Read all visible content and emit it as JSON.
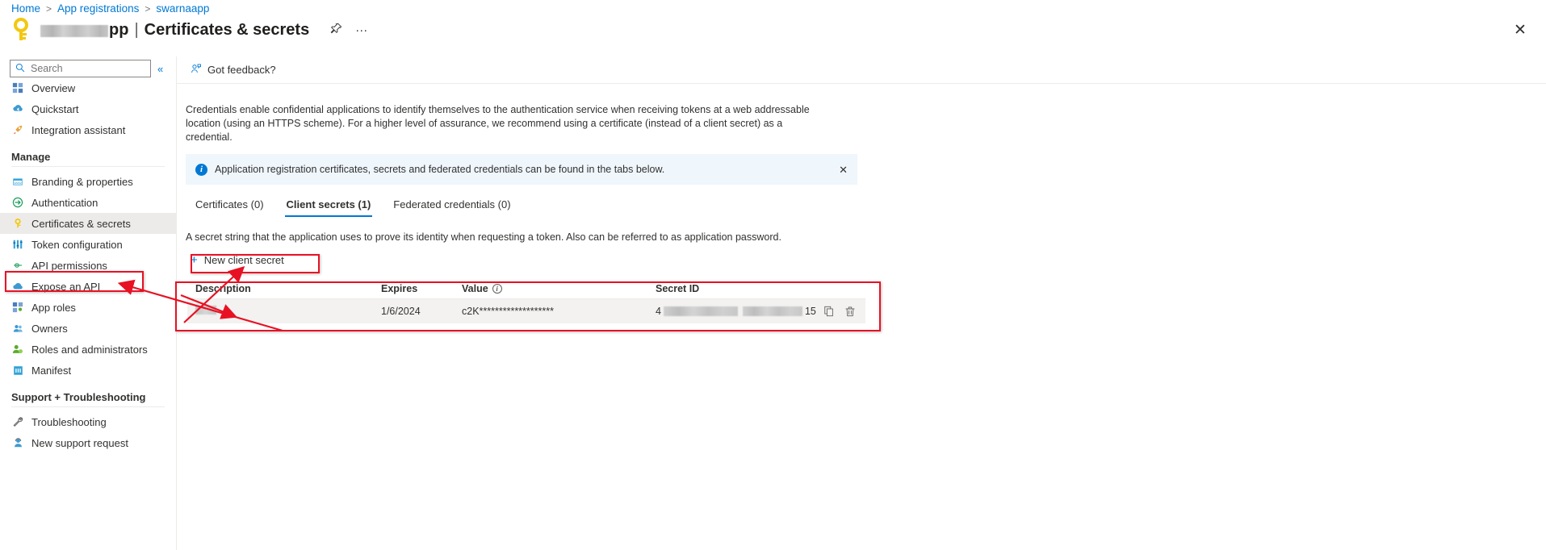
{
  "breadcrumb": {
    "items": [
      "Home",
      "App registrations",
      "swarnaapp"
    ],
    "separator": ">"
  },
  "header": {
    "key_icon": "key-icon",
    "app_name_redacted": true,
    "app_name_visible_suffix": "pp",
    "separator": "|",
    "page_title": "Certificates & secrets",
    "pin_icon": "pin-icon",
    "ellipsis_icon": "more-options-icon",
    "close_icon": "close-icon"
  },
  "sidebar": {
    "search": {
      "placeholder": "Search",
      "value": "",
      "icon": "search-icon"
    },
    "collapse_icon": "«",
    "items": [
      {
        "label": "Overview",
        "icon": "overview-icon",
        "glyph": "▦",
        "color": "#4a7ebb"
      },
      {
        "label": "Quickstart",
        "icon": "quickstart-icon",
        "glyph": "☁",
        "color": "#3d9ad1"
      },
      {
        "label": "Integration assistant",
        "icon": "rocket-icon",
        "glyph": "🚀",
        "color": "#e8a33d"
      }
    ],
    "groups": [
      {
        "title": "Manage",
        "items": [
          {
            "label": "Branding & properties",
            "icon": "branding-icon",
            "glyph": "▤",
            "color": "#31a2d8"
          },
          {
            "label": "Authentication",
            "icon": "authentication-icon",
            "glyph": "➦",
            "color": "#1a9e5c"
          },
          {
            "label": "Certificates & secrets",
            "icon": "key-icon",
            "glyph": "⚷",
            "color": "#f2c811",
            "selected": true
          },
          {
            "label": "Token configuration",
            "icon": "token-configuration-icon",
            "glyph": "⦀",
            "color": "#31a2d8"
          },
          {
            "label": "API permissions",
            "icon": "api-permissions-icon",
            "glyph": "⊸",
            "color": "#1a9e5c"
          },
          {
            "label": "Expose an API",
            "icon": "expose-api-icon",
            "glyph": "☁",
            "color": "#3d9ad1"
          },
          {
            "label": "App roles",
            "icon": "app-roles-icon",
            "glyph": "▦",
            "color": "#4a7ebb"
          },
          {
            "label": "Owners",
            "icon": "owners-icon",
            "glyph": "👥",
            "color": "#3d9ad1"
          },
          {
            "label": "Roles and administrators",
            "icon": "roles-administrators-icon",
            "glyph": "👤",
            "color": "#5cab2e"
          },
          {
            "label": "Manifest",
            "icon": "manifest-icon",
            "glyph": "☲",
            "color": "#31a2d8"
          }
        ]
      },
      {
        "title": "Support + Troubleshooting",
        "items": [
          {
            "label": "Troubleshooting",
            "icon": "troubleshooting-icon",
            "glyph": "🔧",
            "color": "#605e5c"
          },
          {
            "label": "New support request",
            "icon": "support-request-icon",
            "glyph": "👤",
            "color": "#3d9ad1"
          }
        ]
      }
    ]
  },
  "command_bar": {
    "feedback_label": "Got feedback?",
    "feedback_icon": "feedback-icon"
  },
  "main": {
    "description": "Credentials enable confidential applications to identify themselves to the authentication service when receiving tokens at a web addressable location (using an HTTPS scheme). For a higher level of assurance, we recommend using a certificate (instead of a client secret) as a credential.",
    "info_banner": {
      "icon": "info-icon",
      "text": "Application registration certificates, secrets and federated credentials can be found in the tabs below.",
      "close_icon": "close-icon"
    },
    "tabs": [
      {
        "label": "Certificates (0)",
        "active": false
      },
      {
        "label": "Client secrets (1)",
        "active": true
      },
      {
        "label": "Federated credentials (0)",
        "active": false
      }
    ],
    "sub_description": "A secret string that the application uses to prove its identity when requesting a token. Also can be referred to as application password.",
    "new_secret_button": {
      "label": "New client secret",
      "icon": "plus-icon"
    },
    "table": {
      "columns": [
        "Description",
        "Expires",
        "Value",
        "Secret ID"
      ],
      "value_info_icon": "info-icon",
      "rows": [
        {
          "description": "",
          "description_redacted": true,
          "expires": "1/6/2024",
          "value": "c2K*******************",
          "secret_id_prefix": "4",
          "secret_id_suffix": "15",
          "secret_id_redacted": true,
          "copy_icon": "copy-icon",
          "delete_icon": "delete-icon"
        }
      ]
    }
  },
  "annotations": {
    "color": "#e81123",
    "boxes": [
      {
        "name": "sidebar-certificates-highlight"
      },
      {
        "name": "new-client-secret-highlight"
      },
      {
        "name": "secrets-table-highlight"
      }
    ]
  }
}
